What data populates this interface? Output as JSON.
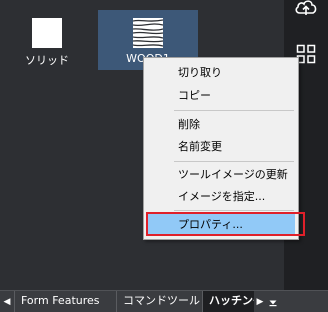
{
  "materials": [
    {
      "label": "ソリッド",
      "swatch": "solid-white"
    },
    {
      "label": "WOOD1",
      "swatch": "wood-grain",
      "selected": true
    }
  ],
  "context_menu": {
    "items": [
      {
        "label": "切り取り"
      },
      {
        "label": "コピー"
      },
      {
        "label": "削除"
      },
      {
        "label": "名前変更"
      },
      {
        "label": "ツールイメージの更新"
      },
      {
        "label": "イメージを指定..."
      },
      {
        "label": "プロパティ...",
        "highlighted": true
      }
    ]
  },
  "right_toolbar": {
    "icons": [
      "cloud-upload-icon",
      "grid-icon"
    ]
  },
  "bottom_tabs": {
    "tabs": [
      {
        "label": "Form Features"
      },
      {
        "label": "コマンドツール"
      },
      {
        "label": "ハッチング",
        "active": true
      }
    ]
  },
  "colors": {
    "selection_bg": "#3d5878",
    "menu_highlight": "#91c9f7",
    "annotation_red": "#e0202a"
  }
}
